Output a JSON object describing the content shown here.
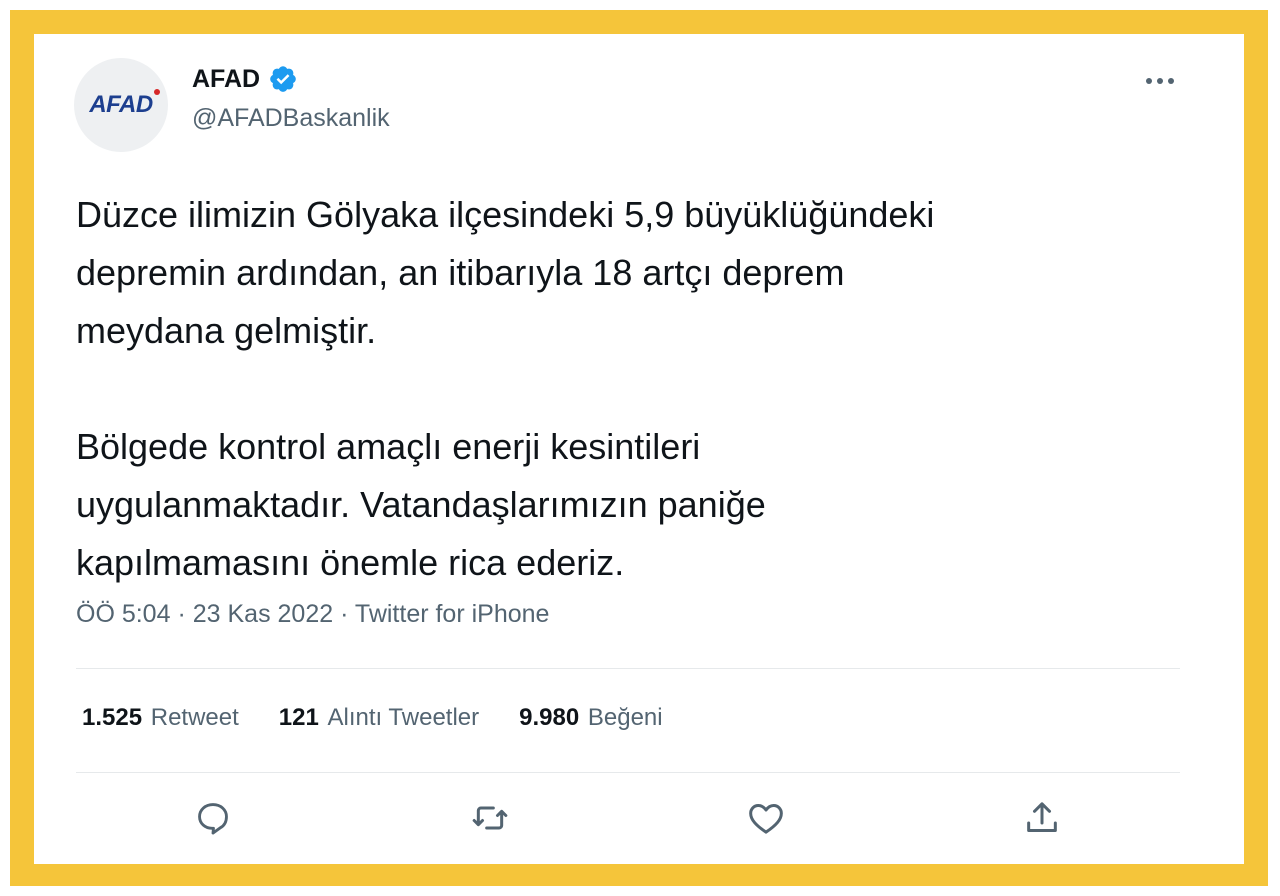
{
  "account": {
    "avatar_text": "AFAD",
    "display_name": "AFAD",
    "handle": "@AFADBaskanlik"
  },
  "tweet": {
    "text": "Düzce ilimizin Gölyaka ilçesindeki 5,9 büyüklüğündeki\ndepremin ardından, an itibarıyla 18 artçı deprem\nmeydana gelmiştir.\n\nBölgede kontrol amaçlı enerji kesintileri\nuygulanmaktadır. Vatandaşlarımızın paniğe\nkapılmamasını önemle rica ederiz.",
    "time": "ÖÖ 5:04",
    "date": "23 Kas 2022",
    "separator": "·",
    "source": "Twitter for iPhone"
  },
  "stats": {
    "retweets": {
      "count": "1.525",
      "label": "Retweet"
    },
    "quotes": {
      "count": "121",
      "label": "Alıntı Tweetler"
    },
    "likes": {
      "count": "9.980",
      "label": "Beğeni"
    }
  },
  "icons": {
    "verified": "verified-badge-icon",
    "more": "more-icon",
    "reply": "reply-icon",
    "retweet": "retweet-icon",
    "like": "heart-icon",
    "share": "share-icon"
  },
  "colors": {
    "frame": "#f5c53a",
    "text": "#0f1419",
    "secondary": "#536471",
    "verified": "#1d9bf0",
    "brand": "#1d3f8f"
  }
}
